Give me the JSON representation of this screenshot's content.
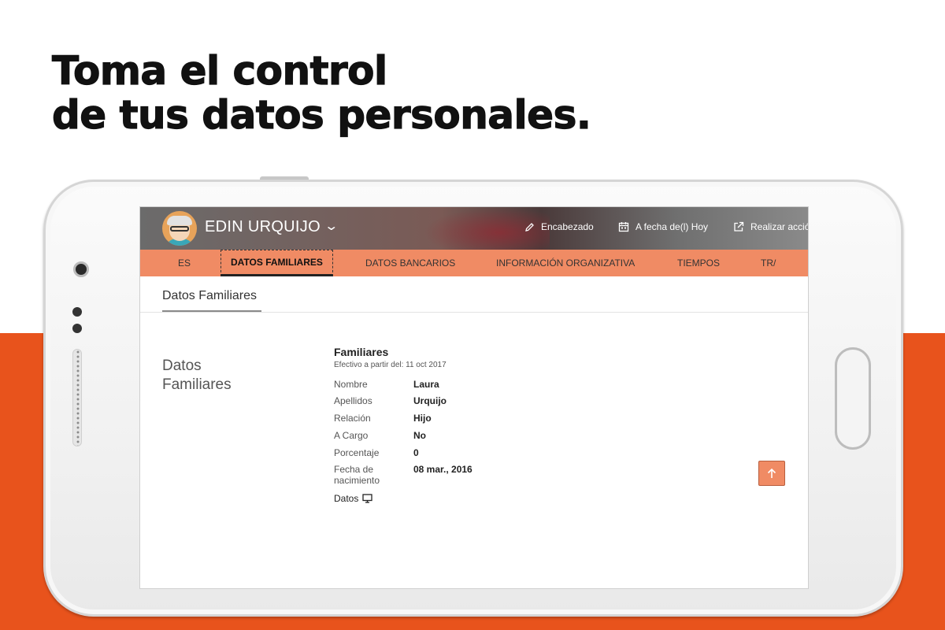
{
  "headline": {
    "line1": "Toma el control",
    "line2": "de tus datos personales."
  },
  "colors": {
    "brand_orange": "#e8531c",
    "tab_orange": "#f08b64"
  },
  "header": {
    "user_name": "EDIN URQUIJO",
    "avatar_icon": "avatar-icon",
    "actions": [
      {
        "label": "Encabezado",
        "icon": "pencil-icon"
      },
      {
        "label": "A fecha de(l) Hoy",
        "icon": "calendar-icon"
      },
      {
        "label": "Realizar acció",
        "icon": "share-icon"
      }
    ]
  },
  "tabs": [
    {
      "label": "ES",
      "active": false
    },
    {
      "label": "DATOS FAMILIARES",
      "active": true
    },
    {
      "label": "DATOS BANCARIOS",
      "active": false
    },
    {
      "label": "INFORMACIÓN ORGANIZATIVA",
      "active": false
    },
    {
      "label": "TIEMPOS",
      "active": false
    },
    {
      "label": "TR/",
      "active": false
    }
  ],
  "section": {
    "heading": "Datos Familiares",
    "side_title_line1": "Datos",
    "side_title_line2": "Familiares"
  },
  "detail": {
    "title": "Familiares",
    "effective": "Efectivo a partir del: 11 oct 2017",
    "rows": [
      {
        "label": "Nombre",
        "value": "Laura"
      },
      {
        "label": "Apellidos",
        "value": "Urquijo"
      },
      {
        "label": "Relación",
        "value": "Hijo"
      },
      {
        "label": "A Cargo",
        "value": "No"
      },
      {
        "label": "Porcentaje",
        "value": "0"
      },
      {
        "label": "Fecha de nacimiento",
        "value": "08 mar., 2016"
      }
    ],
    "link_label": "Datos"
  }
}
